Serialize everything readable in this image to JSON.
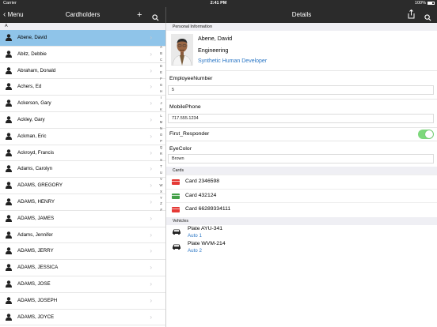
{
  "status_bar": {
    "carrier": "Carrier",
    "time": "2:41 PM",
    "battery": "100%"
  },
  "nav": {
    "menu_label": "Menu",
    "list_title": "Cardholders",
    "add_glyph": "+",
    "details_title": "Details"
  },
  "list": {
    "section_letter": "A",
    "rows": [
      {
        "name": "Abene, David",
        "selected": true
      },
      {
        "name": "Abitz, Debbie"
      },
      {
        "name": "Abraham, Donald"
      },
      {
        "name": "Achers, Ed"
      },
      {
        "name": "Ackerson, Gary"
      },
      {
        "name": "Ackley, Gary"
      },
      {
        "name": "Ackman, Eric"
      },
      {
        "name": "Ackroyd, Francis"
      },
      {
        "name": "Adams, Carolyn"
      },
      {
        "name": "ADAMS, GREGORY"
      },
      {
        "name": "ADAMS, HENRY"
      },
      {
        "name": "ADAMS, JAMES"
      },
      {
        "name": "Adams, Jennifer"
      },
      {
        "name": "ADAMS, JERRY"
      },
      {
        "name": "ADAMS, JESSICA"
      },
      {
        "name": "ADAMS, JOSE"
      },
      {
        "name": "ADAMS, JOSEPH"
      },
      {
        "name": "ADAMS, JOYCE"
      }
    ],
    "index_letters": [
      "A",
      "B",
      "C",
      "D",
      "E",
      "F",
      "G",
      "H",
      "I",
      "J",
      "K",
      "L",
      "M",
      "N",
      "O",
      "P",
      "Q",
      "R",
      "S",
      "T",
      "U",
      "V",
      "W",
      "X",
      "Y",
      "Z",
      "#"
    ]
  },
  "details": {
    "personal_header": "Personal Information",
    "name": "Abene, David",
    "department": "Engineering",
    "title": "Synthetic Human Developer",
    "fields": [
      {
        "label": "EmployeeNumber",
        "value": "5"
      },
      {
        "label": "MobilePhone",
        "value": "717.555.1234"
      }
    ],
    "first_responder": {
      "label": "First_Responder",
      "on": true
    },
    "eye_color": {
      "label": "EyeColor",
      "value": "Brown"
    },
    "cards_header": "Cards",
    "cards": [
      {
        "label": "Card 2346598",
        "color": "#e53935"
      },
      {
        "label": "Card 432124",
        "color": "#43a047"
      },
      {
        "label": "Card 66289334111",
        "color": "#e53935"
      }
    ],
    "vehicles_header": "Vehicles",
    "vehicles": [
      {
        "plate": "Plate AYU-341",
        "name": "Auto 1"
      },
      {
        "plate": "Plate WVM-214",
        "name": "Auto 2"
      }
    ]
  },
  "colors": {
    "nav_bg": "#2b2b2b",
    "selected_row": "#8fc4e9",
    "link_blue": "#2a76c5",
    "toggle_on": "#7dd87b"
  }
}
